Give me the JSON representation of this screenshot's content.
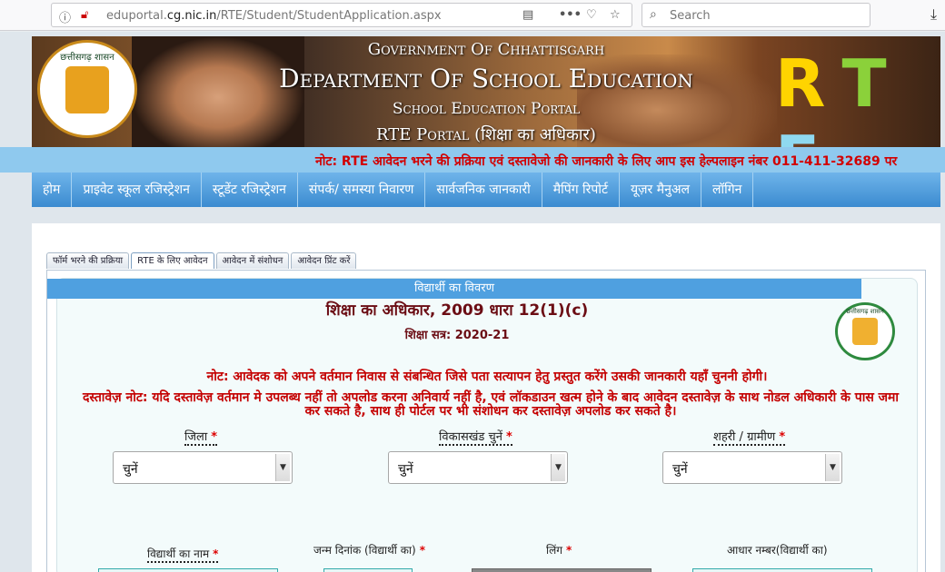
{
  "browser": {
    "url_prefix": "eduportal.",
    "url_domain": "cg.nic.in",
    "url_path": "/RTE/Student/StudentApplication.aspx",
    "search_placeholder": "Search"
  },
  "banner": {
    "line1": "Government Of Chhattisgarh",
    "line2": "Department Of School Education",
    "line3": "School Education Portal",
    "line4": "RTE Portal (शिक्षा का अधिकार)",
    "emblem_text": "छत्तीसगढ़ शासन",
    "logo_letters": [
      "R",
      "T",
      "E"
    ],
    "logo_colors": [
      "#ffd400",
      "#8bd13a",
      "#8fd9f0"
    ]
  },
  "marquee": {
    "text": "नोट: RTE आवेदन भरने की प्रक्रिया एवं दस्तावेजो की जानकारी के लिए आप इस हेल्पलाइन नंबर 011-411-32689 पर"
  },
  "nav": {
    "items": [
      "होम",
      "प्राइवेट स्कूल रजिस्ट्रेशन",
      "स्टूडेंट रजिस्ट्रेशन",
      "संपर्क/ समस्या निवारण",
      "सार्वजनिक जानकारी",
      "मैपिंग रिपोर्ट",
      "यूज़र मैनुअल",
      "लॉगिन"
    ]
  },
  "tabs": [
    "फॉर्म भरने की प्रक्रिया",
    "RTE के लिए आवेदन",
    "आवेदन में संशोधन",
    "आवेदन प्रिंट करें"
  ],
  "form": {
    "title": "शिक्षा का अधिकार, 2009 धारा 12(1)(c)",
    "session": "शिक्षा सत्र: 2020-21",
    "seal_text": "छत्तीसगढ़ शासन",
    "note1": "नोट: आवेदक को अपने वर्तमान निवास से संबन्धित जिसे पता सत्यापन हेतु प्रस्तुत करेंगे उसकी जानकारी यहाँ चुननी होगी।",
    "note2": "दस्तावेज़ नोट: यदि दस्तावेज़ वर्तमान मे उपलब्ध नहीं तो अपलोड करना अनिवार्य नहीं है, एवं लॉकडाउन खत्म होने के बाद आवेदन दस्तावेज़ के साथ नोडल अधिकारी के पास जमा कर सकते है, साथ ही पोर्टल पर भी संशोधन कर दस्तावेज़ अपलोड कर सकते है।",
    "district_label": "जिला",
    "block_label": "विकासखंड चुनें",
    "area_label": "शहरी / ग्रामीण",
    "select_default": "चुनें",
    "required_mark": "*",
    "section_title": "विद्यार्थी का विवरण",
    "student_name_label": "विद्यार्थी का नाम",
    "dob_label": "जन्म दिनांक (विद्यार्थी का)",
    "gender_label": "लिंग",
    "aadhar_label": "आधार नम्बर(विद्यार्थी का)"
  }
}
